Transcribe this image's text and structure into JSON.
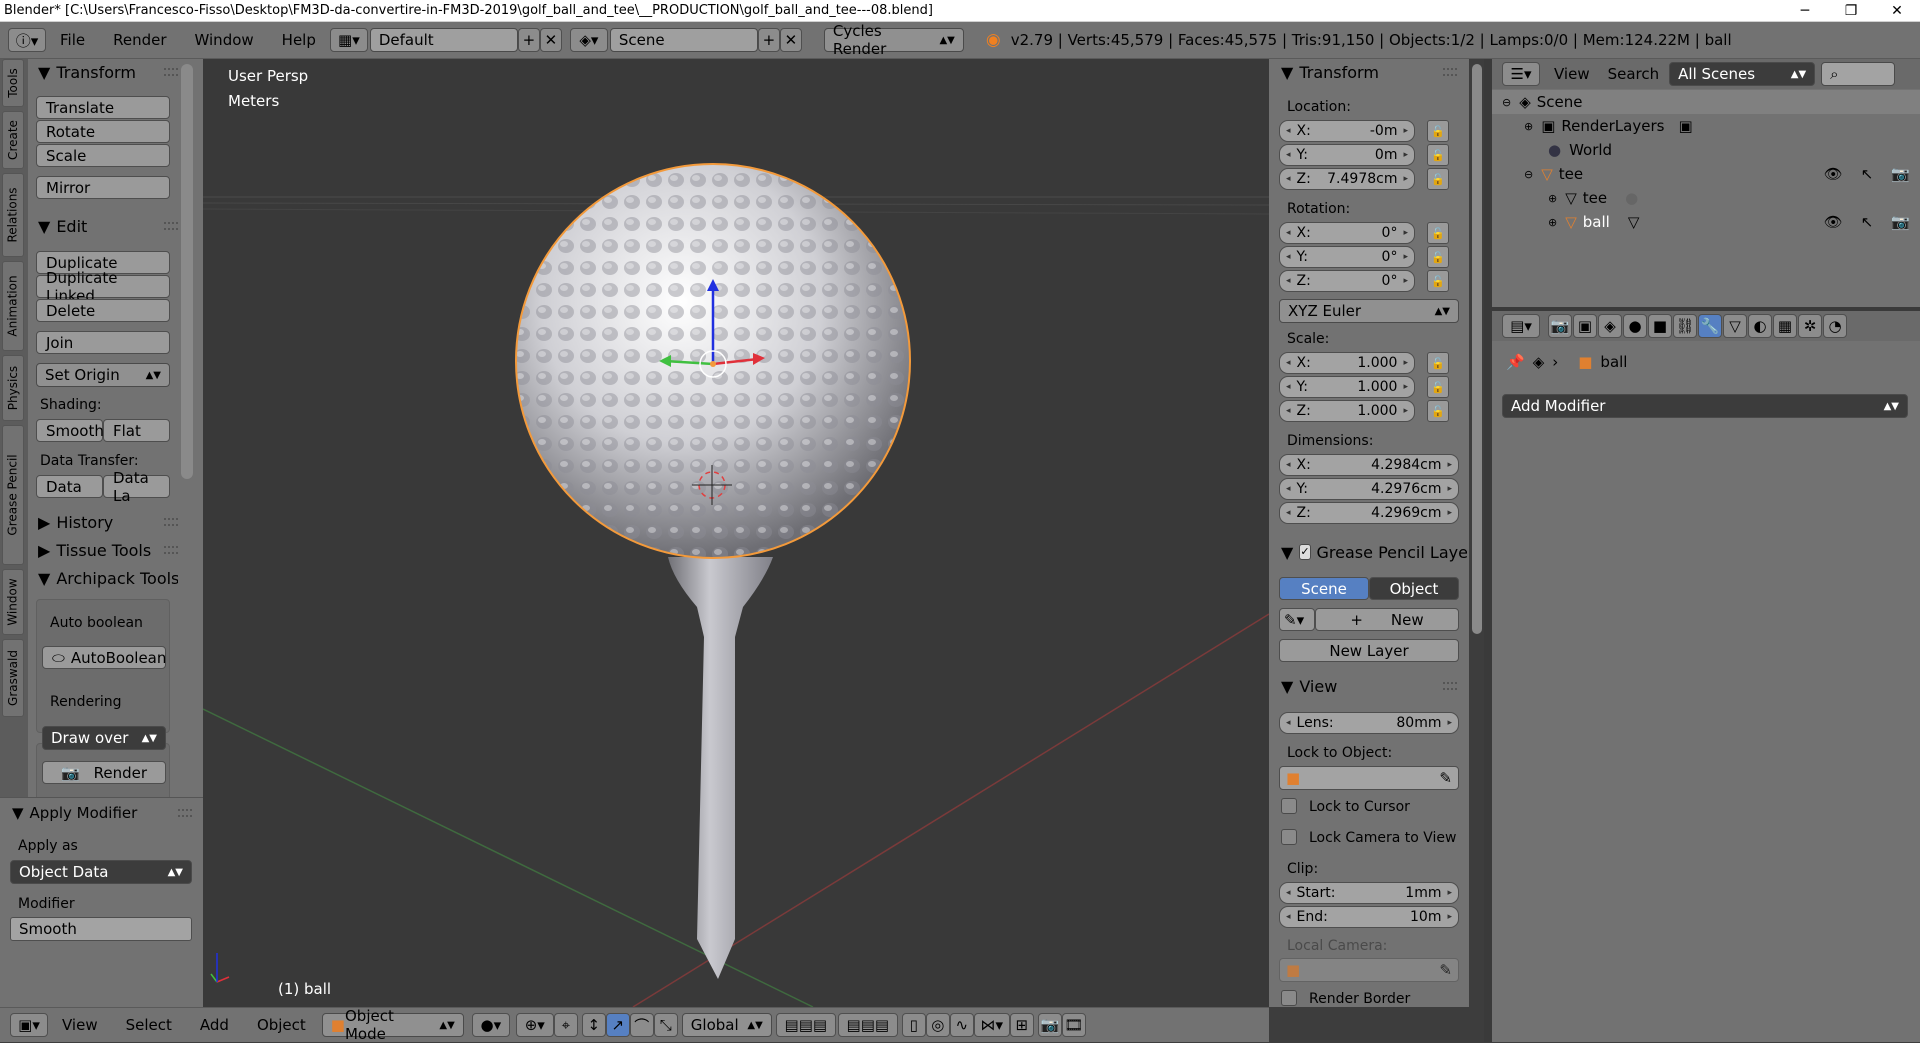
{
  "window": {
    "title": "Blender* [C:\\Users\\Francesco-Fisso\\Desktop\\FM3D-da-convertire-in-FM3D-2019\\golf_ball_and_tee\\__PRODUCTION\\golf_ball_and_tee---08.blend]",
    "minimize": "─",
    "maximize": "❐",
    "close": "✕"
  },
  "header": {
    "menus": [
      "File",
      "Render",
      "Window",
      "Help"
    ],
    "layout": "Default",
    "scene": "Scene",
    "engine": "Cycles Render",
    "stats": "v2.79 | Verts:45,579 | Faces:45,575 | Tris:91,150 | Objects:1/2 | Lamps:0/0 | Mem:124.22M | ball"
  },
  "tool_tabs": [
    "Tools",
    "Create",
    "Relations",
    "Animation",
    "Physics",
    "Grease Pencil",
    "Window",
    "Graswald"
  ],
  "tools": {
    "transform": {
      "title": "Transform",
      "buttons": [
        "Translate",
        "Rotate",
        "Scale",
        "Mirror"
      ]
    },
    "edit": {
      "title": "Edit",
      "buttons": [
        "Duplicate",
        "Duplicate Linked",
        "Delete",
        "Join"
      ],
      "set_origin": "Set Origin",
      "shading_label": "Shading:",
      "smooth": "Smooth",
      "flat": "Flat",
      "data_transfer_label": "Data Transfer:",
      "data": "Data",
      "data_la": "Data La"
    },
    "history": "History",
    "tissue": "Tissue Tools",
    "archipack": "Archipack Tools",
    "auto_boolean_label": "Auto boolean",
    "auto_boolean_btn": "AutoBoolean",
    "rendering_label": "Rendering",
    "draw_over": "Draw over",
    "render_btn": "Render"
  },
  "operator": {
    "title": "Apply Modifier",
    "apply_as_label": "Apply as",
    "apply_as": "Object Data",
    "modifier_label": "Modifier",
    "modifier": "Smooth"
  },
  "viewport": {
    "view_name": "User Persp",
    "units": "Meters",
    "object": "(1) ball"
  },
  "bottom": {
    "menus": [
      "View",
      "Select",
      "Add",
      "Object"
    ],
    "mode": "Object Mode",
    "orientation": "Global"
  },
  "properties": {
    "transform_title": "Transform",
    "location_label": "Location:",
    "location": [
      {
        "a": "X:",
        "v": "-0m"
      },
      {
        "a": "Y:",
        "v": "0m"
      },
      {
        "a": "Z:",
        "v": "7.4978cm"
      }
    ],
    "rotation_label": "Rotation:",
    "rotation": [
      {
        "a": "X:",
        "v": "0°"
      },
      {
        "a": "Y:",
        "v": "0°"
      },
      {
        "a": "Z:",
        "v": "0°"
      }
    ],
    "rotation_mode": "XYZ Euler",
    "scale_label": "Scale:",
    "scale": [
      {
        "a": "X:",
        "v": "1.000"
      },
      {
        "a": "Y:",
        "v": "1.000"
      },
      {
        "a": "Z:",
        "v": "1.000"
      }
    ],
    "dimensions_label": "Dimensions:",
    "dimensions": [
      {
        "a": "X:",
        "v": "4.2984cm"
      },
      {
        "a": "Y:",
        "v": "4.2976cm"
      },
      {
        "a": "Z:",
        "v": "4.2969cm"
      }
    ],
    "gp_title": "Grease Pencil Layer",
    "gp_scene": "Scene",
    "gp_object": "Object",
    "gp_new": "New",
    "gp_new_layer": "New Layer",
    "view_title": "View",
    "lens_label": "Lens:",
    "lens": "80mm",
    "lock_to_object": "Lock to Object:",
    "lock_cursor": "Lock to Cursor",
    "lock_camera": "Lock Camera to View",
    "clip_label": "Clip:",
    "clip_start_label": "Start:",
    "clip_start": "1mm",
    "clip_end_label": "End:",
    "clip_end": "10m",
    "local_camera": "Local Camera:",
    "render_border": "Render Border"
  },
  "outliner": {
    "view": "View",
    "search": "Search",
    "filter": "All Scenes",
    "items": [
      {
        "label": "Scene"
      },
      {
        "label": "RenderLayers"
      },
      {
        "label": "World"
      },
      {
        "label": "tee"
      },
      {
        "label": "tee"
      },
      {
        "label": "ball"
      }
    ]
  },
  "modifiers": {
    "object": "ball",
    "add_modifier": "Add Modifier"
  },
  "colors": {
    "accent": "#5680c2",
    "selection": "#f39a3b",
    "axis_x": "#e0303a",
    "axis_y": "#40c040",
    "axis_z": "#2030e0"
  }
}
